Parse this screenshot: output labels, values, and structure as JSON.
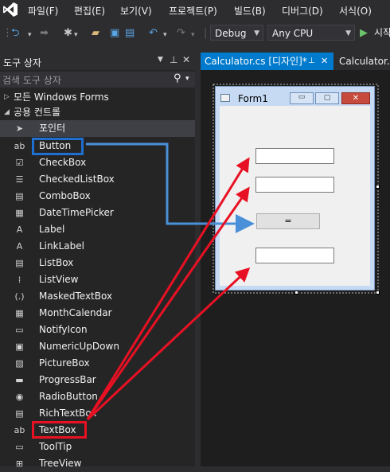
{
  "menu": [
    "파일(F)",
    "편집(E)",
    "보기(V)",
    "프로젝트(P)",
    "빌드(B)",
    "디버그(D)",
    "서식(O)"
  ],
  "toolbar": {
    "config": "Debug",
    "platform": "Any CPU",
    "start_label": "시작"
  },
  "toolbox": {
    "title": "도구 상자",
    "search_placeholder": "검색 도구 상자",
    "all_forms": "모든 Windows Forms",
    "common_controls": "공용 컨트롤",
    "pointer": "포인터",
    "items": [
      "Button",
      "CheckBox",
      "CheckedListBox",
      "ComboBox",
      "DateTimePicker",
      "Label",
      "LinkLabel",
      "ListBox",
      "ListView",
      "MaskedTextBox",
      "MonthCalendar",
      "NotifyIcon",
      "NumericUpDown",
      "PictureBox",
      "ProgressBar",
      "RadioButton",
      "RichTextBox",
      "TextBox",
      "ToolTip",
      "TreeView"
    ]
  },
  "designer": {
    "active_tab": "Calculator.cs [디자인]*",
    "inactive_tab": "Calculator.cs",
    "form_title": "Form1",
    "equals_button": "="
  },
  "colors": {
    "accent": "#007acc",
    "highlight_button": "#1e6fd0",
    "highlight_textbox": "#e81123"
  }
}
